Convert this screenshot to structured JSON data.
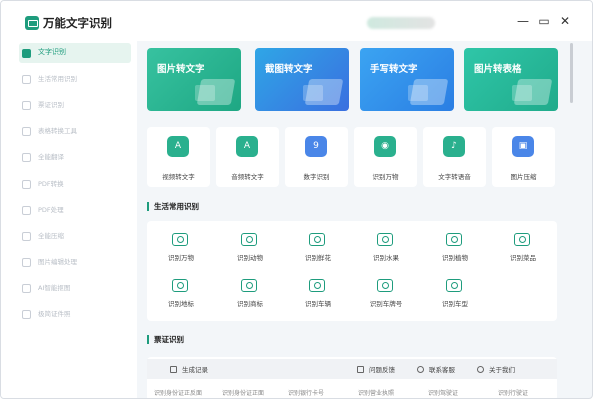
{
  "app": {
    "title": "万能文字识别"
  },
  "window": {
    "minimize": "—",
    "maximize": "▭",
    "close": "✕"
  },
  "sidebar": {
    "items": [
      {
        "label": "文字识别",
        "active": true
      },
      {
        "label": "生活常用识别",
        "active": false
      },
      {
        "label": "票证识别",
        "active": false
      },
      {
        "label": "表格转换工具",
        "active": false
      },
      {
        "label": "全能翻译",
        "active": false
      },
      {
        "label": "PDF转换",
        "active": false
      },
      {
        "label": "PDF处理",
        "active": false
      },
      {
        "label": "全能压缩",
        "active": false
      },
      {
        "label": "图片编辑处理",
        "active": false
      },
      {
        "label": "AI智能抠图",
        "active": false
      },
      {
        "label": "极简证件照",
        "active": false
      }
    ]
  },
  "banners": [
    "图片转文字",
    "截图转文字",
    "手写转文字",
    "图片转表格"
  ],
  "tools": [
    {
      "label": "视频转文字",
      "icon": "A"
    },
    {
      "label": "音频转文字",
      "icon": "A"
    },
    {
      "label": "数字识别",
      "icon": "9"
    },
    {
      "label": "识别万物",
      "icon": "◉"
    },
    {
      "label": "文字转语音",
      "icon": "♪"
    },
    {
      "label": "图片压缩",
      "icon": "▣"
    }
  ],
  "sections": {
    "life": "生活常用识别",
    "cert": "票证识别"
  },
  "life_items": [
    "识别万物",
    "识别动物",
    "识别鲜花",
    "识别水果",
    "识别植物",
    "识别菜品",
    "识别地标",
    "识别商标",
    "识别车辆",
    "识别车牌号",
    "识别车型"
  ],
  "footer": {
    "history": "生成记录",
    "feedback": "问题反馈",
    "support": "联系客服",
    "about": "关于我们"
  },
  "cut_row": [
    "识别身份证正反面",
    "识别身份证正面",
    "识别银行卡号",
    "识别营业执照",
    "识别驾驶证",
    "识别行驶证"
  ]
}
